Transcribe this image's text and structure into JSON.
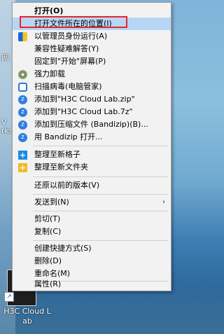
{
  "desktop": {
    "edge_texts": [
      "网",
      "V",
      "rks"
    ],
    "icon_label_line1": "H3C Cloud L",
    "icon_label_line2": "ab"
  },
  "menu": {
    "items": [
      {
        "label": "打开(O)"
      },
      {
        "label": "打开文件所在的位置(I)"
      },
      {
        "label": "以管理员身份运行(A)"
      },
      {
        "label": "兼容性疑难解答(Y)"
      },
      {
        "label": "固定到\"开始\"屏幕(P)"
      },
      {
        "label": "强力卸载"
      },
      {
        "label": "扫描病毒(电脑管家)"
      },
      {
        "label": "添加到\"H3C Cloud Lab.zip\""
      },
      {
        "label": "添加到\"H3C Cloud Lab.7z\""
      },
      {
        "label": "添加到压缩文件 (Bandizip)(B)..."
      },
      {
        "label": "用 Bandizip 打开..."
      },
      {
        "label": "整理至新格子"
      },
      {
        "label": "整理至新文件夹"
      },
      {
        "label": "还原以前的版本(V)"
      },
      {
        "label": "发送到(N)",
        "submenu_arrow": "›"
      },
      {
        "label": "剪切(T)"
      },
      {
        "label": "复制(C)"
      },
      {
        "label": "创建快捷方式(S)"
      },
      {
        "label": "删除(D)"
      },
      {
        "label": "重命名(M)"
      },
      {
        "label": "属性(R)"
      }
    ]
  },
  "colors": {
    "highlight": "#b7d6f4",
    "annotation_box": "#e8242a"
  }
}
